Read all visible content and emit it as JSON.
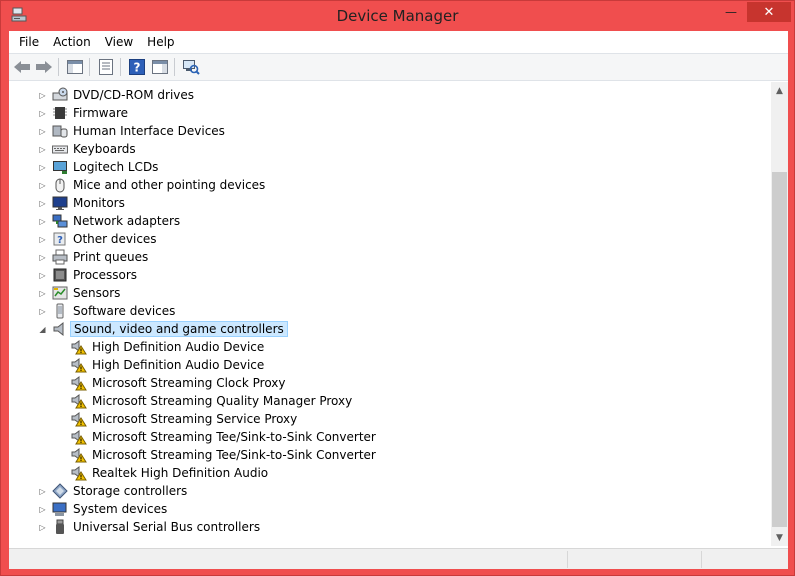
{
  "window": {
    "title": "Device Manager",
    "controls": {
      "minimize": "—",
      "maximize": "☐",
      "close": "✕"
    }
  },
  "menu": [
    "File",
    "Action",
    "View",
    "Help"
  ],
  "toolbar": {
    "buttons": [
      "back-icon",
      "forward-icon",
      "show-hide-console-tree-icon",
      "properties-icon",
      "help-icon",
      "action-pane-icon",
      "scan-hardware-changes-icon"
    ]
  },
  "tree": [
    {
      "label": "DVD/CD-ROM drives",
      "expanded": false,
      "icon": "dvd-drive-icon"
    },
    {
      "label": "Firmware",
      "expanded": false,
      "icon": "firmware-chip-icon"
    },
    {
      "label": "Human Interface Devices",
      "expanded": false,
      "icon": "hid-icon"
    },
    {
      "label": "Keyboards",
      "expanded": false,
      "icon": "keyboard-icon"
    },
    {
      "label": "Logitech LCDs",
      "expanded": false,
      "icon": "lcd-icon"
    },
    {
      "label": "Mice and other pointing devices",
      "expanded": false,
      "icon": "mouse-icon"
    },
    {
      "label": "Monitors",
      "expanded": false,
      "icon": "monitor-icon"
    },
    {
      "label": "Network adapters",
      "expanded": false,
      "icon": "network-adapter-icon"
    },
    {
      "label": "Other devices",
      "expanded": false,
      "icon": "unknown-device-icon"
    },
    {
      "label": "Print queues",
      "expanded": false,
      "icon": "printer-icon"
    },
    {
      "label": "Processors",
      "expanded": false,
      "icon": "processor-icon"
    },
    {
      "label": "Sensors",
      "expanded": false,
      "icon": "sensor-icon"
    },
    {
      "label": "Software devices",
      "expanded": false,
      "icon": "software-device-icon"
    },
    {
      "label": "Sound, video and game controllers",
      "expanded": true,
      "selected": true,
      "icon": "speaker-icon",
      "children": [
        "High Definition Audio Device",
        "High Definition Audio Device",
        "Microsoft Streaming Clock Proxy",
        "Microsoft Streaming Quality Manager Proxy",
        "Microsoft Streaming Service Proxy",
        "Microsoft Streaming Tee/Sink-to-Sink Converter",
        "Microsoft Streaming Tee/Sink-to-Sink Converter",
        "Realtek High Definition Audio"
      ],
      "child_icon": "speaker-warning-icon"
    },
    {
      "label": "Storage controllers",
      "expanded": false,
      "icon": "storage-controller-icon"
    },
    {
      "label": "System devices",
      "expanded": false,
      "icon": "system-devices-icon"
    },
    {
      "label": "Universal Serial Bus controllers",
      "expanded": false,
      "icon": "usb-icon"
    }
  ],
  "colors": {
    "frame": "#f04e4e",
    "close_button": "#c7342e",
    "selection": "#cce8ff",
    "selection_border": "#99d1ff",
    "warning": "#f2c200"
  }
}
